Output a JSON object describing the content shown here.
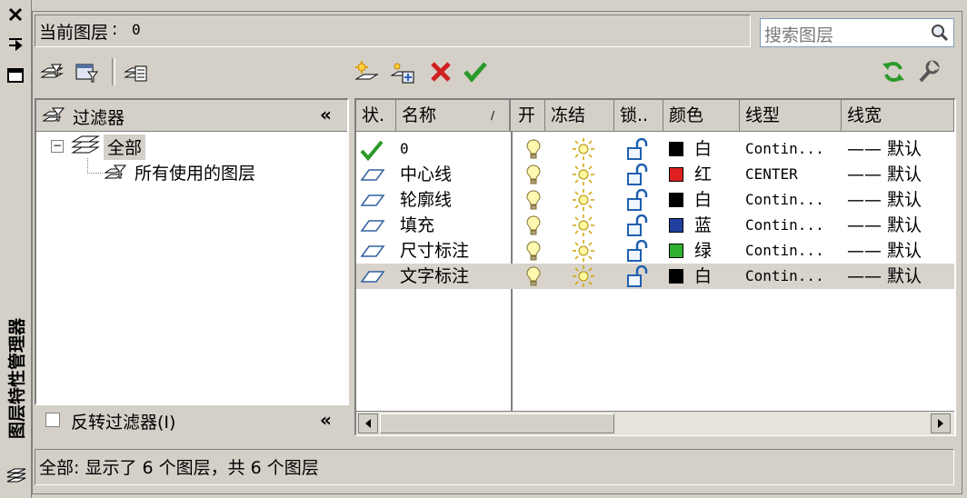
{
  "palette_title": "图层特性管理器",
  "current_layer": {
    "label": "当前图层",
    "value": "0"
  },
  "search": {
    "placeholder": "搜索图层"
  },
  "filter_panel": {
    "header": "过滤器",
    "tree": [
      {
        "label": "全部",
        "selected": true
      },
      {
        "label": "所有使用的图层"
      }
    ],
    "invert_label": "反转过滤器(I)",
    "invert_checked": false
  },
  "layers_table": {
    "columns": {
      "status": "状.",
      "name": "名称",
      "on": "开",
      "freeze": "冻结",
      "lock": "锁..",
      "color": "颜色",
      "linetype": "线型",
      "lineweight": "线宽"
    },
    "rows": [
      {
        "status": "current",
        "name": "0",
        "color_name": "白",
        "color_hex": "#000000",
        "linetype": "Contin...",
        "lineweight": "—— 默认",
        "selected": false
      },
      {
        "status": "layer",
        "name": "中心线",
        "color_name": "红",
        "color_hex": "#e02020",
        "linetype": "CENTER",
        "lineweight": "—— 默认",
        "selected": false
      },
      {
        "status": "layer",
        "name": "轮廓线",
        "color_name": "白",
        "color_hex": "#000000",
        "linetype": "Contin...",
        "lineweight": "—— 默认",
        "selected": false
      },
      {
        "status": "layer",
        "name": "填充",
        "color_name": "蓝",
        "color_hex": "#2040a0",
        "linetype": "Contin...",
        "lineweight": "—— 默认",
        "selected": false
      },
      {
        "status": "layer",
        "name": "尺寸标注",
        "color_name": "绿",
        "color_hex": "#30b030",
        "linetype": "Contin...",
        "lineweight": "—— 默认",
        "selected": false
      },
      {
        "status": "layer",
        "name": "文字标注",
        "color_name": "白",
        "color_hex": "#000000",
        "linetype": "Contin...",
        "lineweight": "—— 默认",
        "selected": true
      }
    ]
  },
  "status_bar": "全部: 显示了 6 个图层，共 6 个图层",
  "colors": {
    "bg": "#d4d0c8",
    "selected_row": "#d4d0c8",
    "refresh_green": "#2a9a2a",
    "delete_red": "#d02020"
  }
}
